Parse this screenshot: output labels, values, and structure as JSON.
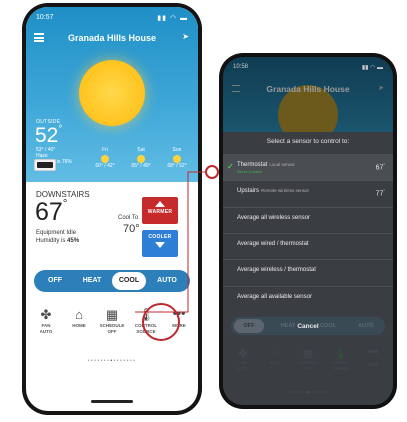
{
  "colors": {
    "warmer": "#c62a2a",
    "cooler": "#2d7fd6",
    "mode_bar": "#2c7fb8",
    "highlight": "#c0282d",
    "selected_check": "#48c74f"
  },
  "left_phone": {
    "status_time": "10:57",
    "house_name": "Granada Hills House",
    "outside": {
      "label": "OUTSIDE",
      "temp": "52",
      "hilo": "53° / 40°",
      "haze": "Haze",
      "humidity": "Humidity is 76%"
    },
    "forecast": [
      {
        "day": "Fri",
        "temps": "60° / 42°",
        "icon": "sun-icon"
      },
      {
        "day": "Sat",
        "temps": "65° / 49°",
        "icon": "sun-icon"
      },
      {
        "day": "Sun",
        "temps": "68° / 52°",
        "icon": "sun-icon"
      }
    ],
    "room": {
      "name": "DOWNSTAIRS",
      "temp": "67",
      "equipment": "Equipment Idle",
      "humidity_prefix": "Humidity is ",
      "humidity_value": "45%",
      "cool_to_label": "Cool To",
      "cool_to_value": "70°"
    },
    "buttons": {
      "warmer": "WARMER",
      "cooler": "COOLER"
    },
    "modes": [
      "OFF",
      "HEAT",
      "COOL",
      "AUTO"
    ],
    "active_mode": "COOL",
    "nav": [
      {
        "label": "FAN\nAUTO",
        "icon": "fan-icon"
      },
      {
        "label": "HOME",
        "icon": "home-icon"
      },
      {
        "label": "SCHEDULE\nOFF",
        "icon": "calendar-icon"
      },
      {
        "label": "CONTROL\nSOURCE",
        "icon": "thermometer-icon"
      },
      {
        "label": "MORE",
        "icon": "more-icon"
      }
    ]
  },
  "right_phone": {
    "status_time": "10:58",
    "house_name": "Granada Hills House",
    "sheet_title": "Select a sensor to control to:",
    "options": [
      {
        "name": "Thermostat",
        "sub": "Local sensor",
        "note": "Set to Control",
        "temp": "67",
        "selected": true
      },
      {
        "name": "Upstairs",
        "sub": "Remote wireless sensor",
        "note": "",
        "temp": "77",
        "selected": false
      },
      {
        "name": "Average all wireless sensor",
        "sub": "",
        "note": "",
        "temp": "",
        "selected": false
      },
      {
        "name": "Average wired / thermostat",
        "sub": "",
        "note": "",
        "temp": "",
        "selected": false
      },
      {
        "name": "Average wireless / thermostat",
        "sub": "",
        "note": "",
        "temp": "",
        "selected": false
      },
      {
        "name": "Average all available sensor",
        "sub": "",
        "note": "",
        "temp": "",
        "selected": false
      }
    ],
    "modes": [
      "OFF",
      "HEAT",
      "COOL",
      "AUTO"
    ],
    "cancel": "Cancel",
    "nav": [
      {
        "label": "FAN\nAUTO"
      },
      {
        "label": "HOME"
      },
      {
        "label": "SCHEDULE\nOFF"
      },
      {
        "label": "CONTROL\nSOURCE"
      },
      {
        "label": "MORE"
      }
    ]
  }
}
